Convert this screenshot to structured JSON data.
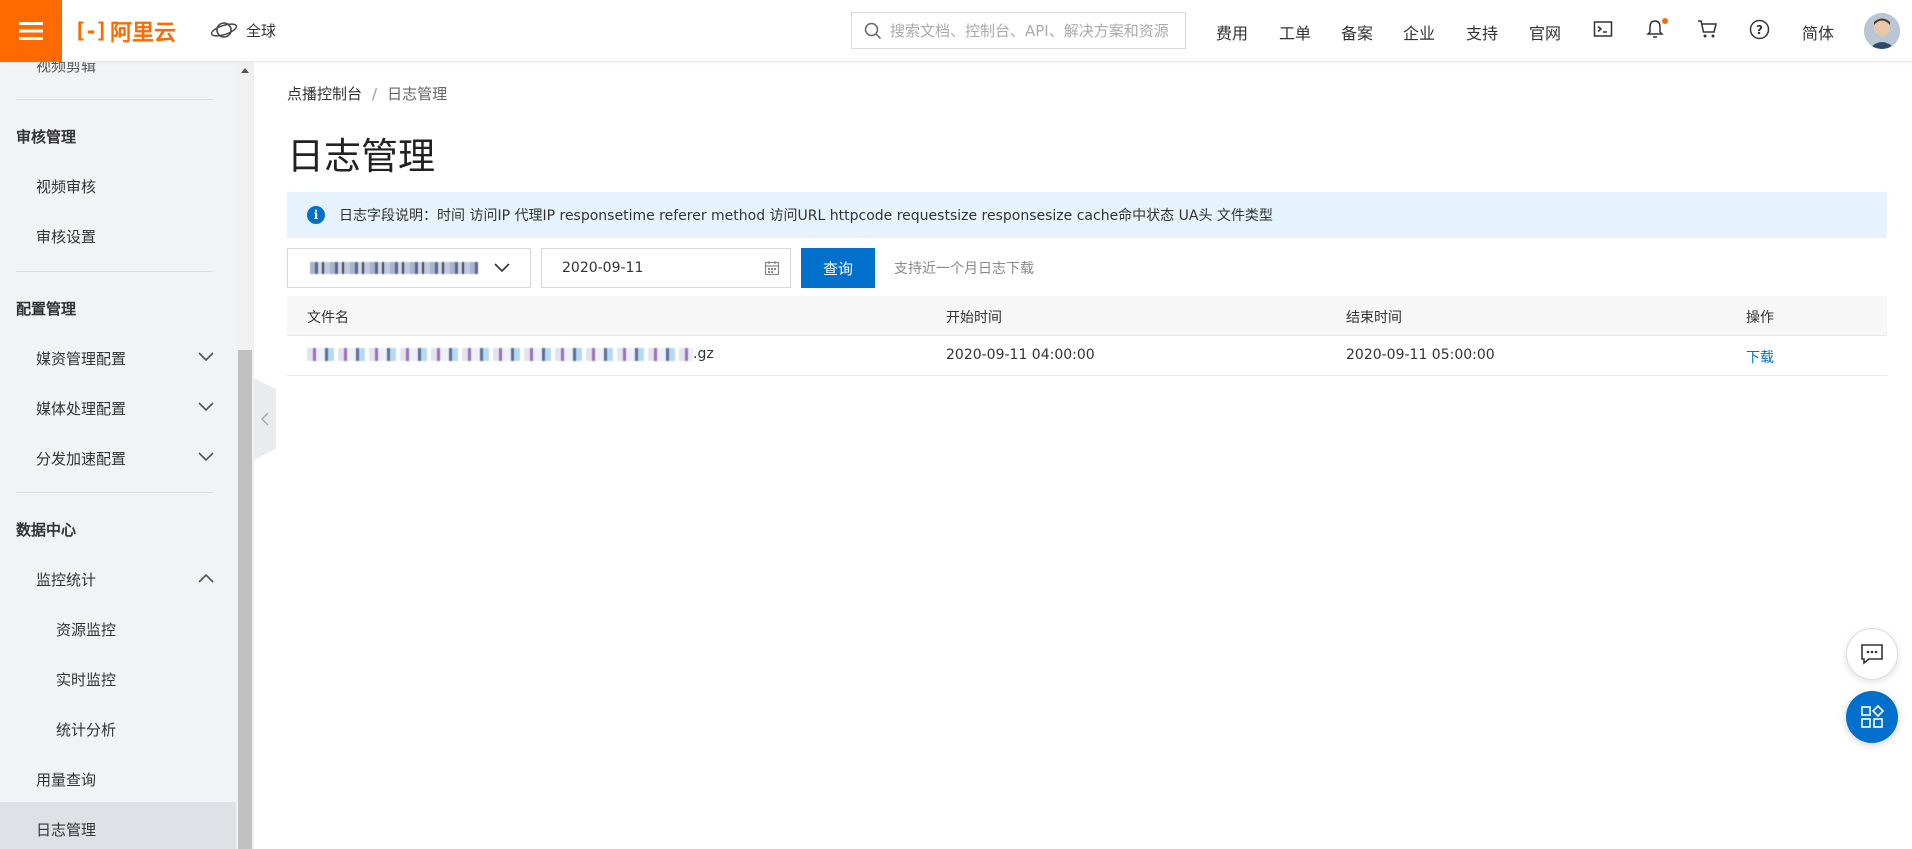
{
  "header": {
    "logo_text": "阿里云",
    "region": "全球",
    "search_placeholder": "搜索文档、控制台、API、解决方案和资源",
    "nav": [
      "费用",
      "工单",
      "备案",
      "企业",
      "支持",
      "官网"
    ],
    "lang": "简体",
    "brand_color": "#ff6a00"
  },
  "sidebar": {
    "top_cut_item": "视频剪辑",
    "groups": [
      {
        "title": "审核管理",
        "items": [
          "视频审核",
          "审核设置"
        ]
      },
      {
        "title": "配置管理",
        "items": [
          "媒资管理配置",
          "媒体处理配置",
          "分发加速配置"
        ]
      },
      {
        "title": "数据中心",
        "items": [
          "监控统计",
          "资源监控",
          "实时监控",
          "统计分析",
          "用量查询",
          "日志管理"
        ]
      }
    ],
    "active_item": "日志管理"
  },
  "main": {
    "breadcrumb": [
      "点播控制台",
      "日志管理"
    ],
    "breadcrumb_sep": "/",
    "title": "日志管理",
    "notice": "日志字段说明：时间 访问IP 代理IP responsetime referer method 访问URL httpcode requestsize responsesize cache命中状态 UA头 文件类型",
    "date_value": "2020-09-11",
    "query_label": "查询",
    "hint": "支持近一个月日志下载",
    "table": {
      "columns": [
        "文件名",
        "开始时间",
        "结束时间",
        "操作"
      ],
      "rows": [
        {
          "file_suffix": ".gz",
          "start": "2020-09-11 04:00:00",
          "end": "2020-09-11 05:00:00",
          "action": "下载"
        }
      ]
    },
    "accent_color": "#0070cc"
  }
}
